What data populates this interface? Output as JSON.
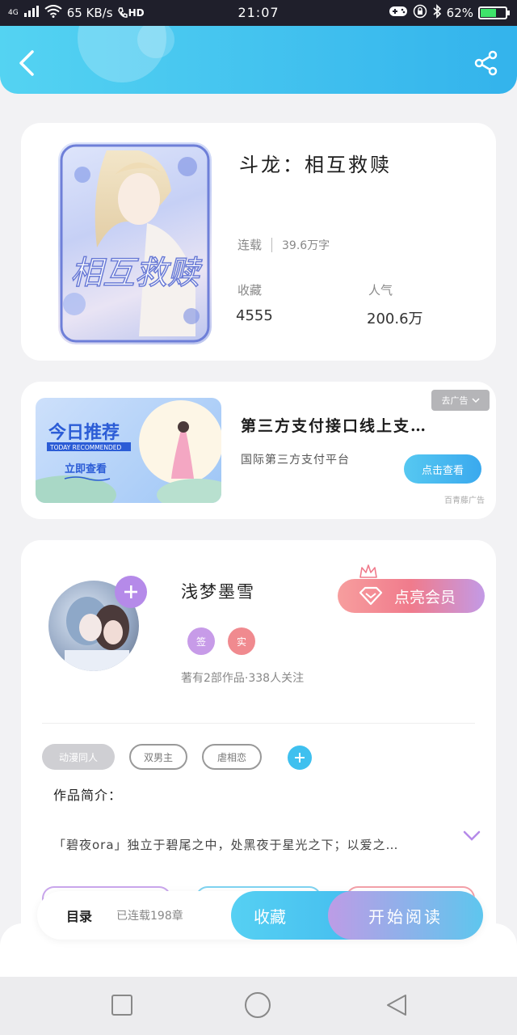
{
  "status_bar": {
    "network": "4G",
    "speed": "65 KB/s",
    "hd": "HD",
    "time": "21:07",
    "battery": "62%",
    "battery_level": 0.62
  },
  "book": {
    "title": "斗龙：相互救赎",
    "status": "连载",
    "word_count": "39.6万字",
    "favorites_label": "收藏",
    "favorites_value": "4555",
    "popularity_label": "人气",
    "popularity_value": "200.6万",
    "cover_text": "相互救赎"
  },
  "ad": {
    "tag": "去广告",
    "image_title": "今日推荐",
    "image_subtitle": "TODAY RECOMMENDED",
    "image_button": "立即查看",
    "title": "第三方支付接口线上支…",
    "subtitle": "国际第三方支付平台",
    "button": "点击查看",
    "source": "百青藤广告"
  },
  "author": {
    "name": "浅梦墨雪",
    "badge_sign": "签",
    "badge_real": "实",
    "stats": "著有2部作品·338人关注",
    "vip_button": "点亮会员"
  },
  "tags": [
    "动漫同人",
    "双男主",
    "虐相恋"
  ],
  "intro": {
    "label": "作品简介：",
    "text": "「碧夜ora」独立于碧尾之中，处黑夜于星光之下；以爱之…"
  },
  "action_bar": {
    "toc": "目录",
    "chapters": "已连载198章",
    "collect": "收藏",
    "read": "开始阅读"
  },
  "colors": {
    "header": "#43c3f0",
    "accent_purple": "#b58ae9",
    "accent_red": "#f07b8c",
    "accent_blue": "#3fc0ef"
  }
}
